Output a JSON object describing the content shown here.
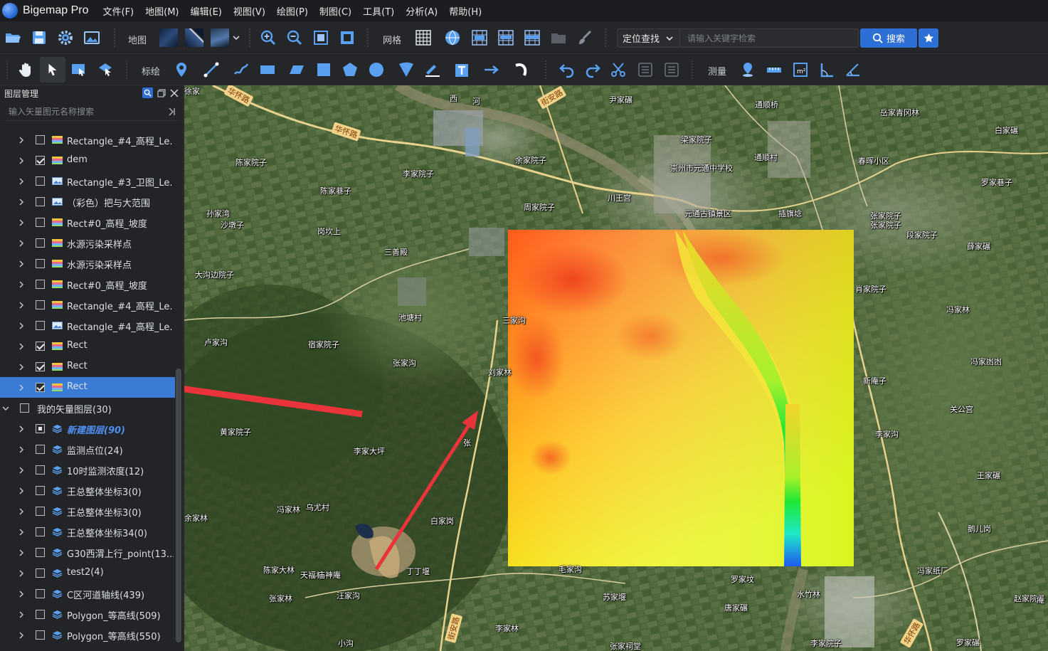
{
  "app": {
    "name": "Bigemap Pro"
  },
  "menu": [
    "文件(F)",
    "地图(M)",
    "编辑(E)",
    "视图(V)",
    "绘图(P)",
    "制图(C)",
    "工具(T)",
    "分析(A)",
    "帮助(H)"
  ],
  "toolbar1": {
    "map_label": "地图",
    "grid_label": "网格",
    "search_mode": "定位查找",
    "search_placeholder": "请输入关键字检索",
    "search_button": "搜索"
  },
  "toolbar2": {
    "annotate_label": "标绘",
    "measure_label": "测量"
  },
  "panel": {
    "title": "图层管理",
    "search_placeholder": "输入矢量图元名称搜索",
    "layers": [
      {
        "label": "Rectangle_#4_高程_Le...",
        "checked": false,
        "kind": "raster",
        "indent": 1
      },
      {
        "label": "dem",
        "checked": true,
        "kind": "raster",
        "indent": 1
      },
      {
        "label": "Rectangle_#3_卫图_Le...",
        "checked": false,
        "kind": "image",
        "indent": 1
      },
      {
        "label": "（彩色）把与大范围",
        "checked": false,
        "kind": "image",
        "indent": 1
      },
      {
        "label": "Rect#0_高程_坡度",
        "checked": false,
        "kind": "raster",
        "indent": 1
      },
      {
        "label": "水源污染采样点",
        "checked": false,
        "kind": "raster",
        "indent": 1
      },
      {
        "label": "水源污染采样点",
        "checked": false,
        "kind": "raster",
        "indent": 1
      },
      {
        "label": "Rect#0_高程_坡度",
        "checked": false,
        "kind": "raster",
        "indent": 1
      },
      {
        "label": "Rectangle_#4_高程_Le...",
        "checked": false,
        "kind": "raster",
        "indent": 1
      },
      {
        "label": "Rectangle_#4_高程_Le...",
        "checked": false,
        "kind": "image",
        "indent": 1
      },
      {
        "label": "Rect",
        "checked": true,
        "kind": "raster",
        "indent": 1
      },
      {
        "label": "Rect",
        "checked": true,
        "kind": "raster",
        "indent": 1
      },
      {
        "label": "Rect",
        "checked": true,
        "kind": "raster",
        "indent": 1,
        "selected": true
      },
      {
        "label": "我的矢量图层(30)",
        "checked": false,
        "kind": "group",
        "indent": 0,
        "expanded": true
      },
      {
        "label": "新建图层(90)",
        "checked": "partial",
        "kind": "vector",
        "indent": 1,
        "active": true
      },
      {
        "label": "监测点位(24)",
        "checked": false,
        "kind": "vector",
        "indent": 1
      },
      {
        "label": "10时监测浓度(12)",
        "checked": false,
        "kind": "vector",
        "indent": 1
      },
      {
        "label": "王总整体坐标3(0)",
        "checked": false,
        "kind": "vector",
        "indent": 1
      },
      {
        "label": "王总整体坐标3(0)",
        "checked": false,
        "kind": "vector",
        "indent": 1
      },
      {
        "label": "王总整体坐标34(0)",
        "checked": false,
        "kind": "vector",
        "indent": 1
      },
      {
        "label": "G30西渭上行_point(13...",
        "checked": false,
        "kind": "vector",
        "indent": 1
      },
      {
        "label": "test2(4)",
        "checked": false,
        "kind": "vector",
        "indent": 1
      },
      {
        "label": "C区河道轴线(439)",
        "checked": false,
        "kind": "vector",
        "indent": 1
      },
      {
        "label": "Polygon_等高线(509)",
        "checked": false,
        "kind": "vector",
        "indent": 1
      },
      {
        "label": "Polygon_等高线(550)",
        "checked": false,
        "kind": "vector",
        "indent": 1
      }
    ]
  },
  "map": {
    "roads": [
      "华怀路",
      "华怀路",
      "街安路",
      "西",
      "河",
      "街安路",
      "华怀路"
    ],
    "places": [
      "尹家碾",
      "通顺桥",
      "岳家青冈林",
      "白家碾",
      "梁家院子",
      "通顺村",
      "春晖小区",
      "余家院子",
      "崇州市元通中学校",
      "陈家院子",
      "李家院子",
      "罗家巷子",
      "陈家巷子",
      "川王宫",
      "周家院子",
      "元通古镇景区",
      "插旗埝",
      "张家院子",
      "孙家湾",
      "沙墩子",
      "张家院子",
      "段家院子",
      "岗坎上",
      "薛家碾",
      "三善殿",
      "大沟边院子",
      "肖家院子",
      "冯家林",
      "池塘村",
      "宿家院子",
      "卢家沟",
      "张家沟",
      "冯家凼凼",
      "刘家林",
      "新庵子",
      "关公宫",
      "黄家院子",
      "李家大坪",
      "李家沟",
      "王家碾",
      "冯家林",
      "乌尤村",
      "鹅儿岗",
      "白家岗",
      "陈家大林",
      "天福村",
      "庙神庵",
      "丁丁堰",
      "毛家沟",
      "罗家坟",
      "冯家纸厂",
      "张家林",
      "汪家沟",
      "苏家堰",
      "水竹林",
      "赵家院子",
      "唐家碾",
      "李家林",
      "张家祠堂",
      "小沟",
      "李家院子",
      "罗家碾",
      "余家林",
      "三家沟",
      "张",
      "庵",
      "徐家"
    ]
  },
  "colors": {
    "accent": "#2e6fd6",
    "selection": "#3a7bd5",
    "arrow": "#e8343a"
  }
}
